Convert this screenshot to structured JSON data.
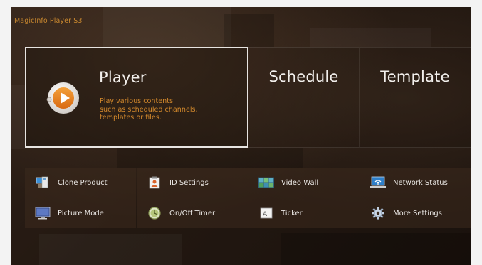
{
  "app_title": "MagicInfo Player S3",
  "tiles": {
    "player": {
      "title": "Player",
      "description": [
        "Play various contents",
        "such as scheduled channels,",
        "templates or files."
      ],
      "icon": "play-icon"
    },
    "schedule": {
      "title": "Schedule"
    },
    "template": {
      "title": "Template"
    }
  },
  "menu": {
    "items": [
      {
        "label": "Clone Product",
        "icon": "clone-product-icon"
      },
      {
        "label": "ID Settings",
        "icon": "id-badge-icon"
      },
      {
        "label": "Video Wall",
        "icon": "video-wall-icon"
      },
      {
        "label": "Network Status",
        "icon": "network-status-icon"
      },
      {
        "label": "Picture Mode",
        "icon": "monitor-icon"
      },
      {
        "label": "On/Off Timer",
        "icon": "clock-icon"
      },
      {
        "label": "Ticker",
        "icon": "ticker-icon"
      },
      {
        "label": "More Settings",
        "icon": "gear-icon"
      }
    ]
  },
  "colors": {
    "accent": "#d4892c",
    "title_text": "#f2efec",
    "focus_border": "#e7e4e1",
    "background": "#231811",
    "page_background": "#f3f3f3"
  }
}
